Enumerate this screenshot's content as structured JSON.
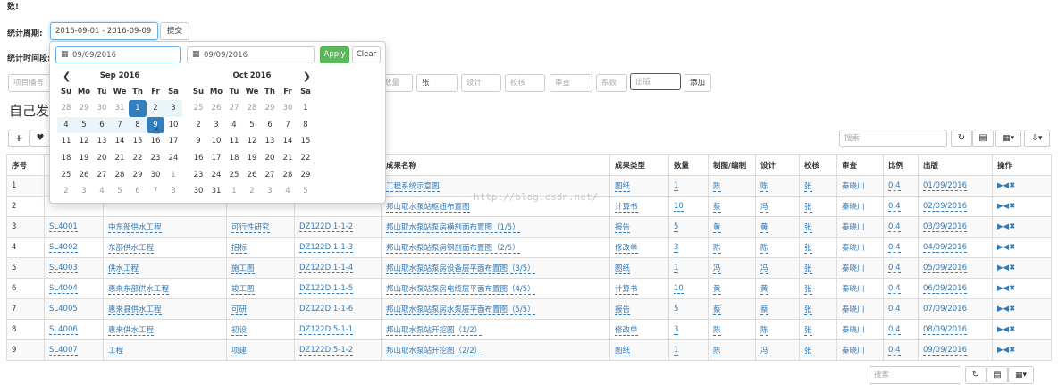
{
  "top_label": "数!",
  "period": {
    "label": "统计周期:",
    "value": "2016-09-01 - 2016-09-09",
    "submit": "提交"
  },
  "time_label": "统计时间段:",
  "form": {
    "project_ph": "项目编号",
    "qty_ph": "数量",
    "unit_value": "张",
    "design_ph": "设计",
    "check_ph": "校核",
    "review_ph": "审查",
    "coef_ph": "系数",
    "pub_ph": "出版",
    "add_label": "添加"
  },
  "section_title": "自己发",
  "toolbar": {
    "add_icon": "plus-icon",
    "fav_icon": "heart-icon",
    "search_ph": "搜索"
  },
  "picker": {
    "start_value": "09/09/2016",
    "end_value": "09/09/2016",
    "apply": "Apply",
    "clear": "Clear",
    "weekdays": [
      "Su",
      "Mo",
      "Tu",
      "We",
      "Th",
      "Fr",
      "Sa"
    ],
    "left": {
      "title": "Sep 2016",
      "weeks": [
        [
          "28",
          "29",
          "30",
          "31",
          "1",
          "2",
          "3"
        ],
        [
          "4",
          "5",
          "6",
          "7",
          "8",
          "9",
          "10"
        ],
        [
          "11",
          "12",
          "13",
          "14",
          "15",
          "16",
          "17"
        ],
        [
          "18",
          "19",
          "20",
          "21",
          "22",
          "23",
          "24"
        ],
        [
          "25",
          "26",
          "27",
          "28",
          "29",
          "30",
          "1"
        ],
        [
          "2",
          "3",
          "4",
          "5",
          "6",
          "7",
          "8"
        ]
      ]
    },
    "right": {
      "title": "Oct 2016",
      "weeks": [
        [
          "25",
          "26",
          "27",
          "28",
          "29",
          "30",
          "1"
        ],
        [
          "2",
          "3",
          "4",
          "5",
          "6",
          "7",
          "8"
        ],
        [
          "9",
          "10",
          "11",
          "12",
          "13",
          "14",
          "15"
        ],
        [
          "16",
          "17",
          "18",
          "19",
          "20",
          "21",
          "22"
        ],
        [
          "23",
          "24",
          "25",
          "26",
          "27",
          "28",
          "29"
        ],
        [
          "30",
          "31",
          "1",
          "2",
          "3",
          "4",
          "5"
        ]
      ]
    }
  },
  "watermark": "http://blog.csdn.net/",
  "table": {
    "headers": [
      "序号",
      "",
      "",
      "",
      "",
      "成果名称",
      "成果类型",
      "数量",
      "制图/编制",
      "设计",
      "校核",
      "审查",
      "比例",
      "出版",
      "操作"
    ],
    "rows": [
      [
        "1",
        "",
        "",
        "",
        "",
        "工程系统示意图",
        "图纸",
        "1",
        "陈",
        "陈",
        "张",
        "秦晓川",
        "0.4",
        "01/09/2016"
      ],
      [
        "2",
        "",
        "",
        "",
        "",
        "邦山取水泵站枢纽布置图",
        "计算书",
        "10",
        "蔡",
        "冯",
        "张",
        "秦晓川",
        "0.4",
        "02/09/2016"
      ],
      [
        "3",
        "SL4001",
        "中东部供水工程",
        "可行性研究",
        "DZ122D.1-1-2",
        "邦山取水泵站泵房横剖面布置图（1/5）",
        "报告",
        "5",
        "黄",
        "黄",
        "张",
        "秦晓川",
        "0.4",
        "03/09/2016"
      ],
      [
        "4",
        "SL4002",
        "东部供水工程",
        "招标",
        "DZ122D.1-1-3",
        "邦山取水泵站泵房钢剖面布置图（2/5）",
        "修改单",
        "3",
        "陈",
        "陈",
        "张",
        "秦晓川",
        "0.4",
        "04/09/2016"
      ],
      [
        "5",
        "SL4003",
        "供水工程",
        "施工图",
        "DZ122D.1-1-4",
        "邦山取水泵站泵房设备层平面布置图（3/5）",
        "图纸",
        "1",
        "冯",
        "冯",
        "张",
        "秦晓川",
        "0.4",
        "05/09/2016"
      ],
      [
        "6",
        "SL4004",
        "惠来东部供水工程",
        "竣工图",
        "DZ122D.1-1-5",
        "邦山取水泵站泵房电缆层平面布置图（4/5）",
        "计算书",
        "10",
        "黄",
        "黄",
        "张",
        "秦晓川",
        "0.4",
        "06/09/2016"
      ],
      [
        "7",
        "SL4005",
        "惠来县供水工程",
        "可研",
        "DZ122D.1-1-6",
        "邦山取水泵站泵房水泵层平面布置图（5/5）",
        "报告",
        "5",
        "蔡",
        "蔡",
        "张",
        "秦晓川",
        "0.4",
        "07/09/2016"
      ],
      [
        "8",
        "SL4006",
        "惠来供水工程",
        "初设",
        "DZ122D.5-1-1",
        "邦山取水泵站开挖图（1/2）",
        "修改单",
        "3",
        "陈",
        "陈",
        "张",
        "秦晓川",
        "0.4",
        "08/09/2016"
      ],
      [
        "9",
        "SL4007",
        "工程",
        "项建",
        "DZ122D.5-1-2",
        "邦山取水泵站开挖图（2/2）",
        "图纸",
        "1",
        "陈",
        "冯",
        "张",
        "秦晓川",
        "0.4",
        "09/09/2016"
      ]
    ],
    "ops_text": "▶◀✖"
  },
  "bottom": {
    "search_ph": "搜索"
  }
}
